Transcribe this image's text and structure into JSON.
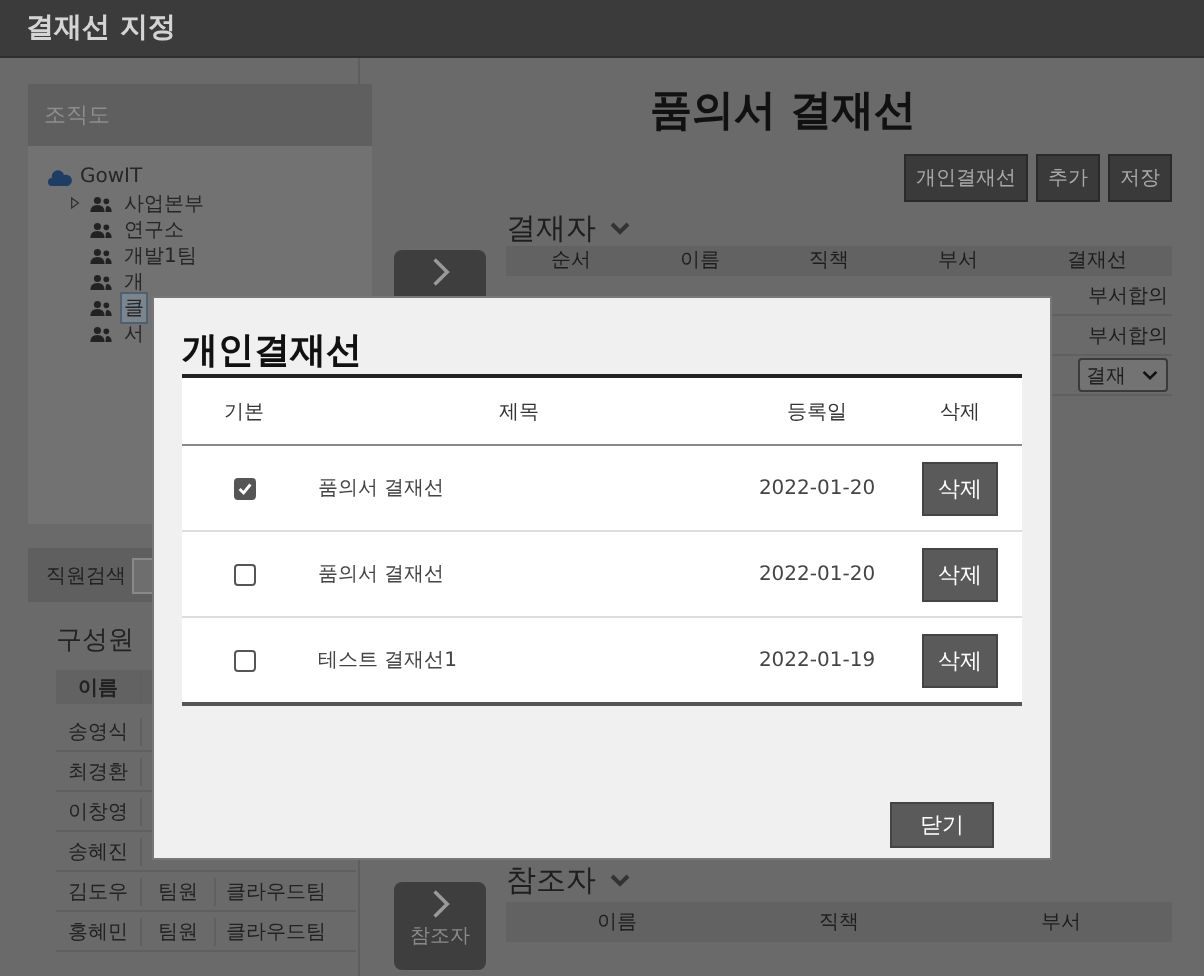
{
  "window": {
    "title": "결재선 지정"
  },
  "org_chart": {
    "title": "조직도",
    "root": {
      "label": "GowIT",
      "children": [
        {
          "label": "사업본부",
          "collapsed": true,
          "selected": false
        },
        {
          "label": "연구소",
          "collapsed": false,
          "selected": false
        },
        {
          "label": "개발1팀",
          "collapsed": false,
          "selected": false
        },
        {
          "label": "개",
          "collapsed": false,
          "selected": false
        },
        {
          "label": "클",
          "collapsed": false,
          "selected": true
        },
        {
          "label": "서",
          "collapsed": false,
          "selected": false
        }
      ]
    }
  },
  "employee_search": {
    "label": "직원검색"
  },
  "members": {
    "title": "구성원",
    "columns": [
      "이름"
    ],
    "rows": [
      [
        "송영식"
      ],
      [
        "최경환"
      ],
      [
        "이창영"
      ],
      [
        "송혜진"
      ],
      [
        "김도우",
        "팀원",
        "클라우드팀"
      ],
      [
        "홍혜민",
        "팀원",
        "클라우드팀"
      ]
    ]
  },
  "main": {
    "title": "품의서 결재선",
    "buttons": [
      "개인결재선",
      "추가",
      "저장"
    ]
  },
  "approvers": {
    "title": "결재자",
    "columns": [
      "순서",
      "이름",
      "직책",
      "부서",
      "결재선"
    ],
    "rows": [
      {
        "kind": "text",
        "approval_line": "부서합의"
      },
      {
        "kind": "text",
        "approval_line": "부서합의"
      },
      {
        "kind": "select",
        "approval_line": "결재"
      }
    ]
  },
  "references": {
    "title": "참조자",
    "button": "참조자",
    "columns": [
      "이름",
      "직책",
      "부서"
    ]
  },
  "dialog": {
    "title": "개인결재선",
    "columns": [
      "기본",
      "제목",
      "등록일",
      "삭제"
    ],
    "rows": [
      {
        "checked": true,
        "title": "품의서 결재선",
        "date": "2022-01-20",
        "action": "삭제"
      },
      {
        "checked": false,
        "title": "품의서 결재선",
        "date": "2022-01-20",
        "action": "삭제"
      },
      {
        "checked": false,
        "title": "테스트 결재선1",
        "date": "2022-01-19",
        "action": "삭제"
      }
    ],
    "close": "닫기"
  }
}
